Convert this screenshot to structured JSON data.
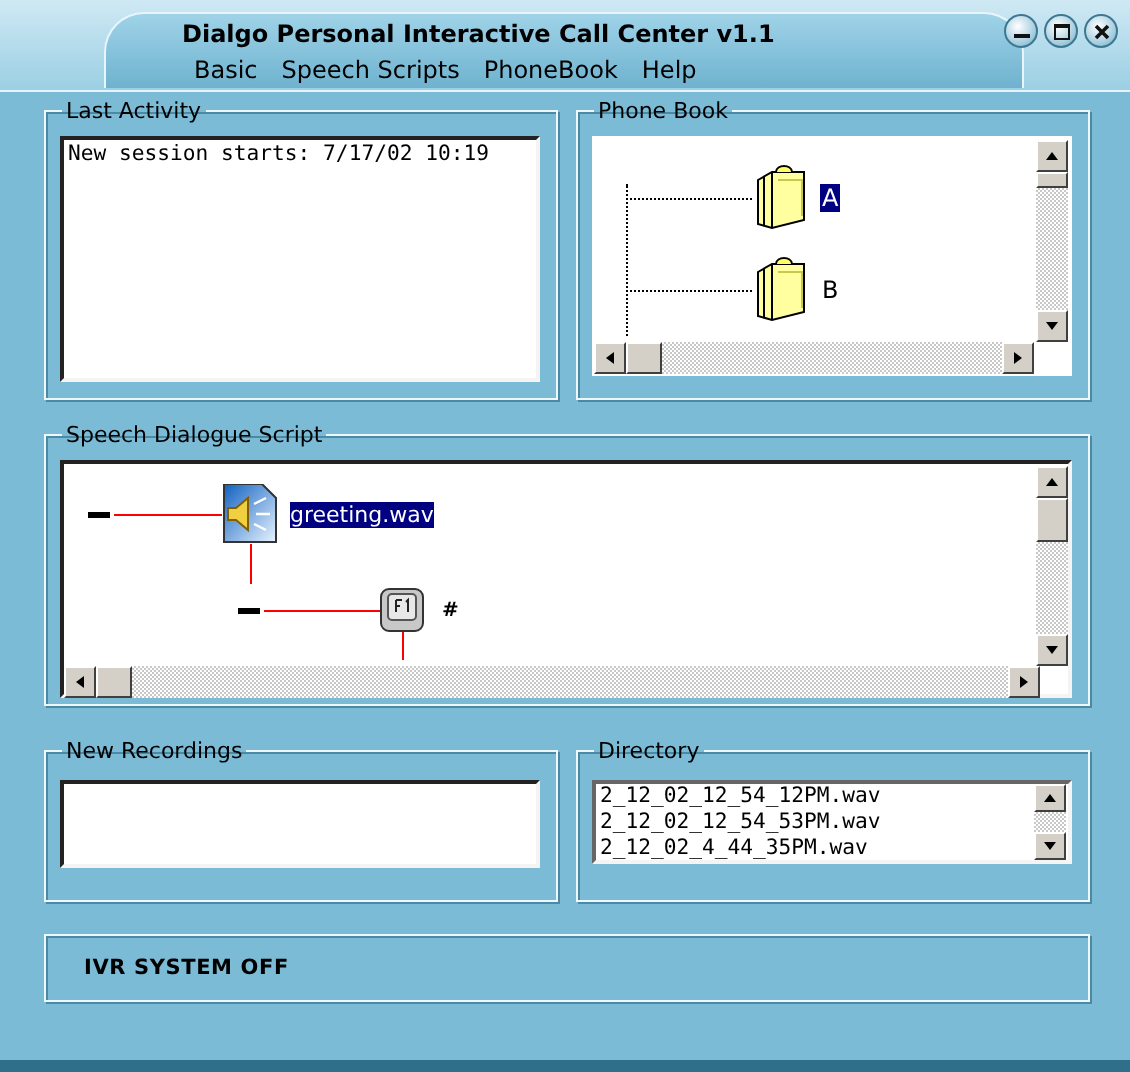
{
  "window": {
    "title": "Dialgo Personal Interactive Call Center v1.1"
  },
  "menu": [
    "Basic",
    "Speech Scripts",
    "PhoneBook",
    "Help"
  ],
  "last_activity": {
    "title": "Last Activity",
    "lines": [
      "New session starts: 7/17/02 10:19"
    ]
  },
  "phone_book": {
    "title": "Phone Book",
    "entries": [
      {
        "label": "A",
        "selected": true
      },
      {
        "label": "B",
        "selected": false
      }
    ]
  },
  "script": {
    "title": "Speech Dialogue Script",
    "nodes": [
      {
        "kind": "audio",
        "label": "greeting.wav",
        "selected": true
      },
      {
        "kind": "key",
        "label": "#",
        "selected": false
      }
    ]
  },
  "new_recordings": {
    "title": "New Recordings"
  },
  "directory": {
    "title": "Directory",
    "files": [
      "2_12_02_12_54_12PM.wav",
      "2_12_02_12_54_53PM.wav",
      "2_12_02_4_44_35PM.wav"
    ]
  },
  "status": "IVR SYSTEM OFF"
}
